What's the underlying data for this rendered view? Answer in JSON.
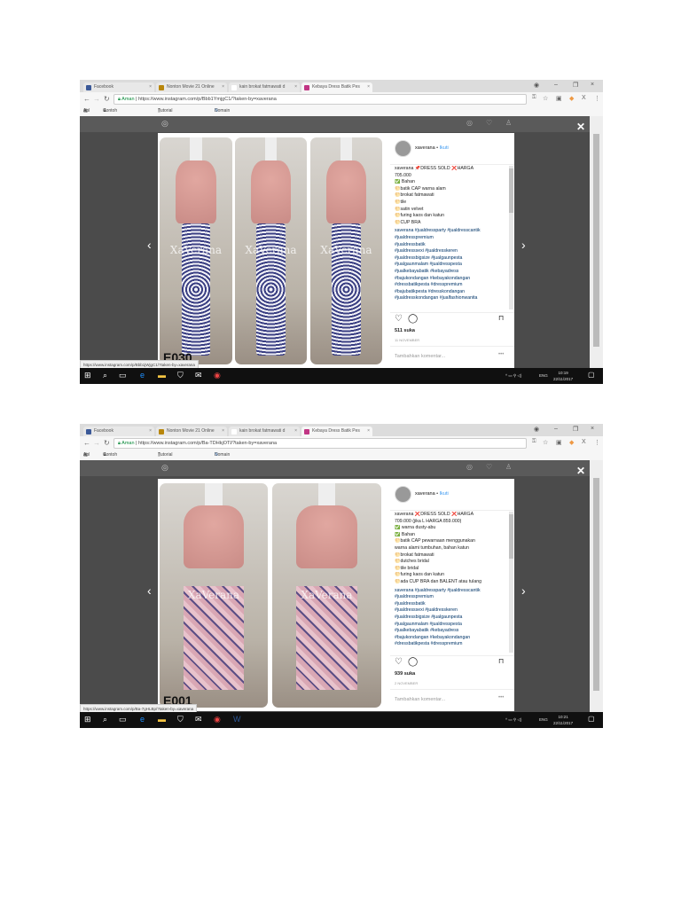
{
  "shots": [
    {
      "tabs": [
        "Facebook",
        "Nonton Movie 21 Online",
        "kain brokat fatmawati d",
        "Kebaya Dress Batik Pes"
      ],
      "url_secure": "Aman",
      "url": "https://www.instagram.com/p/Bbb1YmjgC1/?taken-by=xaverana",
      "bookmarks": [
        "Apl",
        "Contoh Makalah Stu",
        "Tutorial Belajar Word",
        "Domain Murah | Bali"
      ],
      "username": "xaverana",
      "follow": "Ikuti",
      "caption": [
        "xaverana 📌DRESS SOLD ❌HARGA",
        "705.000",
        "✅ Bahan",
        "🌕batik CAP warna alam",
        "🌕brokat fatmawati",
        "🌕tile",
        "🌕satin velvet",
        "🌕furing kaos dan katun",
        "🌕CUP BRA"
      ],
      "hashtags": [
        "xaverana #jualdressparty #jualdresscantik",
        "#jualdresspremium",
        "#jualdressbatik",
        "#jualdresssexi #jualdresskeren",
        "#jualdressbigsize #jualgaunpesta",
        "#jualgaunmalam #jualdresspesta",
        "#jualkebayabatik #kebayadress",
        "#bajukondangan #kebayakondangan",
        "#dressbatikpesta #dresspremium",
        "#bajubatikpesta #dresskondangan",
        "#jualdresskondangan #jualfashionwanita"
      ],
      "likes": "511 suka",
      "date": "11 NOVEMBER",
      "comment_placeholder": "Tambahkan komentar...",
      "more": "•••",
      "watermark": "XaVerana",
      "code": "E030",
      "status_url": "https://www.instagram.com/p/Bbb1jWjgC1/?taken-by=xaverana",
      "time": "10:19",
      "sysdate": "22/11/2017",
      "lang": "ENG"
    },
    {
      "tabs": [
        "Facebook",
        "Nonton Movie 21 Online",
        "kain brokat fatmawati d",
        "Kebaya Dress Batik Pes"
      ],
      "url_secure": "Aman",
      "url": "https://www.instagram.com/p/Ba-TDHkjOTl/?taken-by=xaverana",
      "bookmarks": [
        "Apl",
        "Contoh Makalah Stu",
        "Tutorial Belajar Word",
        "Domain Murah | Bali"
      ],
      "username": "xaverana",
      "follow": "Ikuti",
      "caption": [
        "xaverana ❌DRESS SOLD ❌HARGA",
        "709.000 (jika L HARGA 859.000)",
        "✅ warna dusty-abu",
        "✅ Bahan",
        "🌕batik CAP pewarnaan menggunakan",
        "warna alami tumbuhan, bahan katun",
        "🌕brokat fatmawati",
        "🌕dutches bridal",
        "🌕tile bridal",
        "🌕furing kaos dan katun",
        "🌕ada CUP BRA dan BALENT atau tulang"
      ],
      "hashtags": [
        "xaverana #jualdressparty #jualdresscantik",
        "#jualdresspremium",
        "#jualdressbatik",
        "#jualdresssexi #jualdresskeren",
        "#jualdressbigsize #jualgaunpesta",
        "#jualgaunmalam #jualdresspesta",
        "#jualkebayabatik #kebayadress",
        "#bajukondangan #kebayakondangan",
        "#dressbatikpesta #dresspremium"
      ],
      "likes": "939 suka",
      "date": "2 NOVEMBER",
      "comment_placeholder": "Tambahkan komentar...",
      "more": "•••",
      "watermark": "XaVerana",
      "code": "E001",
      "status_url": "https://www.instagram.com/p/Ba-7gHLBp/?taken-by=xaverana",
      "time": "10:21",
      "sysdate": "22/11/2017",
      "lang": "ENG"
    }
  ]
}
